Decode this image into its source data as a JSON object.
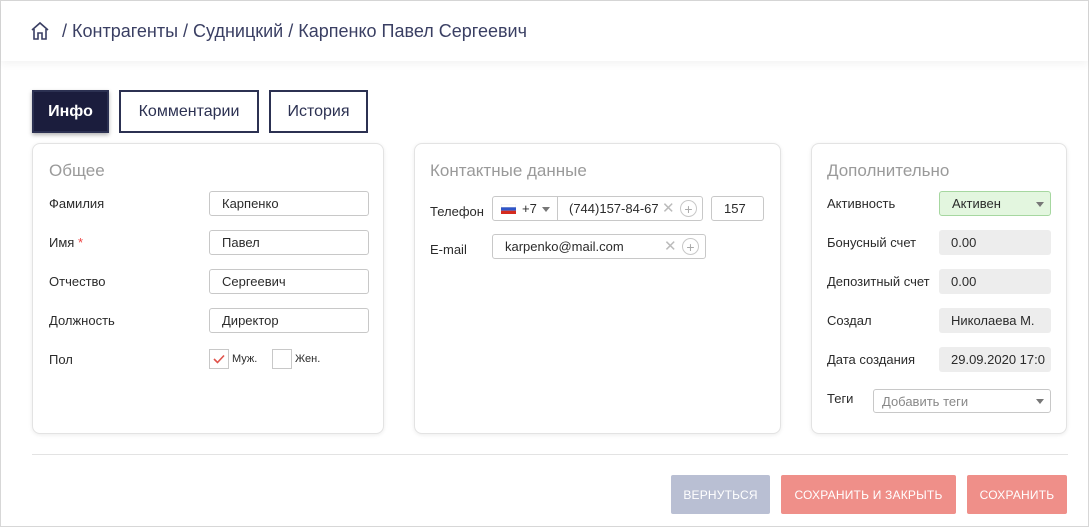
{
  "breadcrumb": [
    "Контрагенты",
    "Судницкий",
    "Карпенко Павел Сергеевич"
  ],
  "breadcrumb_sep": "/",
  "tabs": [
    {
      "label": "Инфо",
      "active": true
    },
    {
      "label": "Комментарии",
      "active": false
    },
    {
      "label": "История",
      "active": false
    }
  ],
  "general": {
    "title": "Общее",
    "lastname_label": "Фамилия",
    "lastname_value": "Карпенко",
    "firstname_label": "Имя",
    "required_mark": "*",
    "firstname_value": "Павел",
    "middlename_label": "Отчество",
    "middlename_value": "Сергеевич",
    "position_label": "Должность",
    "position_value": "Директор",
    "gender_label": "Пол",
    "gender_male": "Муж.",
    "gender_female": "Жен.",
    "gender_male_checked": true,
    "gender_female_checked": false
  },
  "contacts": {
    "title": "Контактные данные",
    "phone_label": "Телефон",
    "phone_code": "+7",
    "phone_value": "(744)157-84-67",
    "phone_ext": "157",
    "email_label": "E-mail",
    "email_value": "karpenko@mail.com"
  },
  "extra": {
    "title": "Дополнительно",
    "activity_label": "Активность",
    "activity_value": "Активен",
    "bonus_label": "Бонусный счет",
    "bonus_value": "0.00",
    "deposit_label": "Депозитный счет",
    "deposit_value": "0.00",
    "creator_label": "Создал",
    "creator_value": "Николаева М.",
    "created_label": "Дата создания",
    "created_value": "29.09.2020 17:0",
    "tags_label": "Теги",
    "tags_placeholder": "Добавить теги"
  },
  "buttons": {
    "back": "ВЕРНУТЬСЯ",
    "save_close": "СОХРАНИТЬ И ЗАКРЫТЬ",
    "save": "СОХРАНИТЬ"
  },
  "colors": {
    "accent_dark": "#1b1d3d",
    "btn_back": "#b9bfd3",
    "btn_save": "#ef8f89",
    "active_green": "#e3f6df"
  },
  "icons": {
    "home": "home-icon",
    "flag": "russia-flag-icon",
    "clear": "clear-x-icon",
    "add": "add-circle-icon",
    "check": "checkmark-icon",
    "dropdown": "chevron-down-icon"
  }
}
